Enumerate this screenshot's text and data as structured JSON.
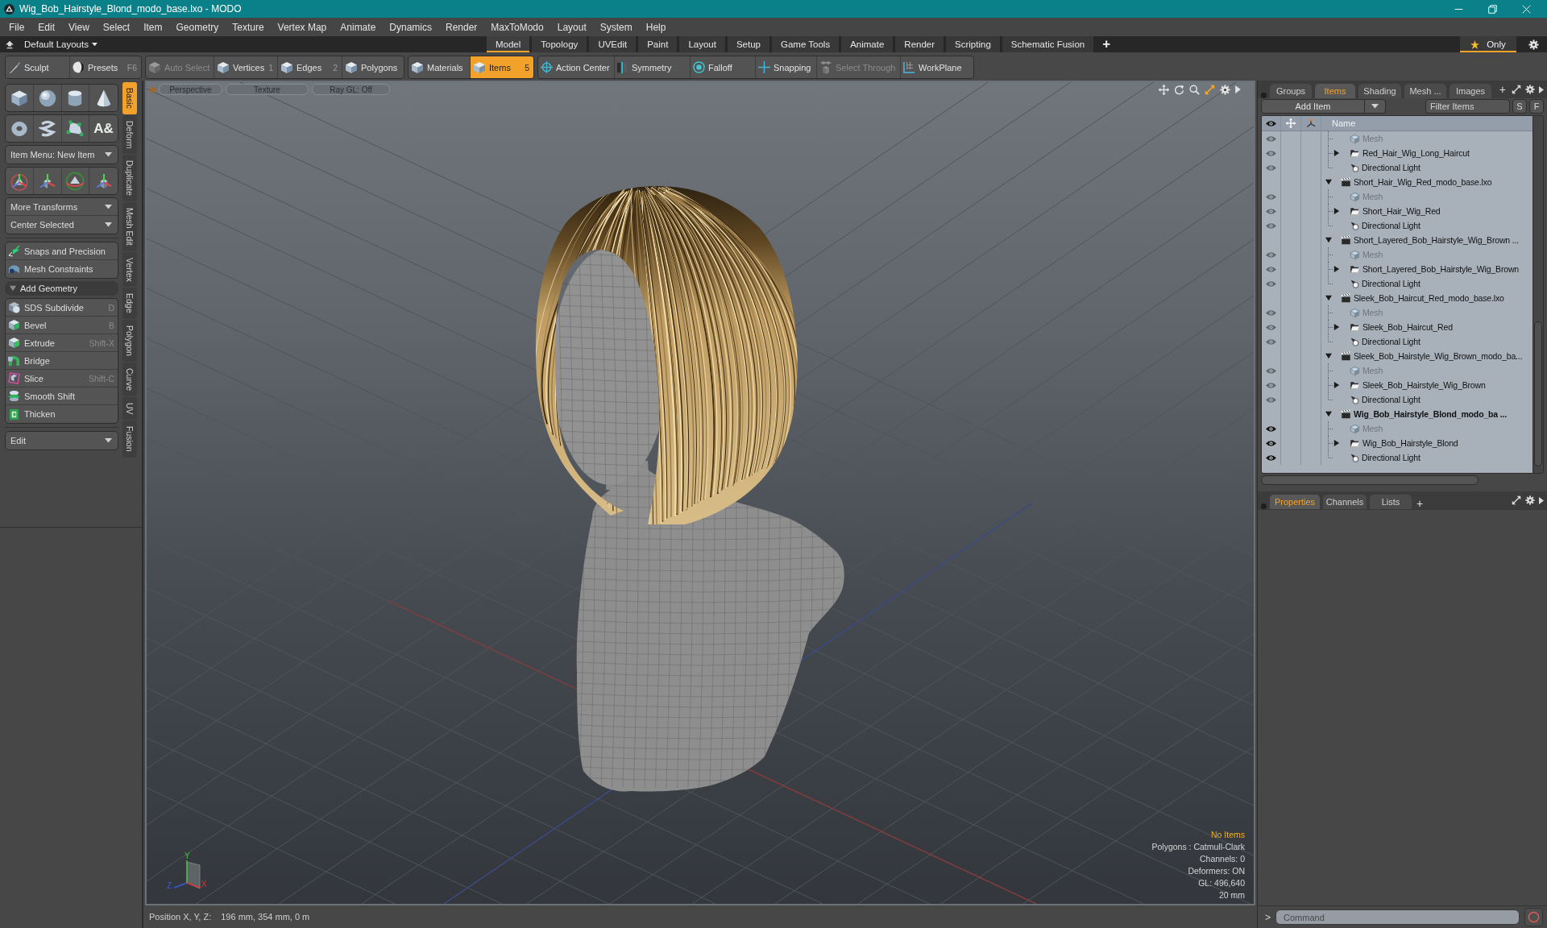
{
  "window": {
    "title": "Wig_Bob_Hairstyle_Blond_modo_base.lxo - MODO"
  },
  "menu": [
    "File",
    "Edit",
    "View",
    "Select",
    "Item",
    "Geometry",
    "Texture",
    "Vertex Map",
    "Animate",
    "Dynamics",
    "Render",
    "MaxToModo",
    "Layout",
    "System",
    "Help"
  ],
  "layout_bar": {
    "preset": "Default Layouts",
    "tabs": [
      {
        "label": "Model",
        "selected": true
      },
      {
        "label": "Topology",
        "selected": false
      },
      {
        "label": "UVEdit",
        "selected": false
      },
      {
        "label": "Paint",
        "selected": false
      },
      {
        "label": "Layout",
        "selected": false
      },
      {
        "label": "Setup",
        "selected": false
      },
      {
        "label": "Game Tools",
        "selected": false
      },
      {
        "label": "Animate",
        "selected": false
      },
      {
        "label": "Render",
        "selected": false
      },
      {
        "label": "Scripting",
        "selected": false
      },
      {
        "label": "Schematic Fusion",
        "selected": false
      }
    ],
    "add_tab": "+",
    "only_filter": {
      "label": "Only",
      "on": true
    }
  },
  "toolbar": {
    "groups": [
      {
        "buttons": [
          {
            "label": "Sculpt",
            "selected": false,
            "disabled": false
          },
          {
            "label": "Presets",
            "shortcut": "F6",
            "selected": false,
            "disabled": false
          }
        ]
      },
      {
        "buttons": [
          {
            "label": "Auto Select",
            "selected": false,
            "disabled": true
          },
          {
            "label": "Vertices",
            "shortcut": "1",
            "selected": false,
            "disabled": false
          },
          {
            "label": "Edges",
            "shortcut": "2",
            "selected": false,
            "disabled": false
          },
          {
            "label": "Polygons",
            "selected": false,
            "disabled": false
          }
        ]
      },
      {
        "buttons": [
          {
            "label": "Materials",
            "selected": false,
            "disabled": false
          },
          {
            "label": "Items",
            "shortcut": "5",
            "selected": true,
            "disabled": false
          }
        ]
      },
      {
        "buttons": [
          {
            "label": "Action Center",
            "selected": false,
            "disabled": false
          },
          {
            "label": "Symmetry",
            "selected": false,
            "disabled": false
          },
          {
            "label": "Falloff",
            "selected": false,
            "disabled": false
          },
          {
            "label": "Snapping",
            "selected": false,
            "disabled": false
          },
          {
            "label": "Select Through",
            "selected": false,
            "disabled": true
          },
          {
            "label": "WorkPlane",
            "selected": false,
            "disabled": false
          }
        ]
      }
    ]
  },
  "tool_palette": {
    "text_tool": "A&",
    "item_menu": "Item Menu: New Item",
    "transform_menus": [
      "More Transforms",
      "Center Selected"
    ],
    "constraints": [
      "Snaps and Precision",
      "Mesh Constraints"
    ],
    "add_geometry": {
      "title": "Add Geometry",
      "expanded": true,
      "tools": [
        {
          "label": "SDS Subdivide",
          "shortcut": "D"
        },
        {
          "label": "Bevel",
          "shortcut": "B"
        },
        {
          "label": "Extrude",
          "shortcut": "Shift-X"
        },
        {
          "label": "Bridge"
        },
        {
          "label": "Slice",
          "shortcut": "Shift-C"
        },
        {
          "label": "Smooth Shift"
        },
        {
          "label": "Thicken"
        }
      ]
    },
    "edit_menu": "Edit"
  },
  "side_tabs": [
    {
      "label": "Basic",
      "selected": true
    },
    {
      "label": "Deform",
      "selected": false
    },
    {
      "label": "Duplicate",
      "selected": false
    },
    {
      "label": "Mesh Edit",
      "selected": false
    },
    {
      "label": "Vertex",
      "selected": false
    },
    {
      "label": "Edge",
      "selected": false
    },
    {
      "label": "Polygon",
      "selected": false
    },
    {
      "label": "Curve",
      "selected": false
    },
    {
      "label": "UV",
      "selected": false
    },
    {
      "label": "Fusion",
      "selected": false
    }
  ],
  "viewport": {
    "view_buttons": [
      "Perspective",
      "Texture",
      "Ray GL: Off"
    ],
    "selection": "No Items",
    "stats": [
      "Polygons : Catmull-Clark",
      "Channels: 0",
      "Deformers: ON",
      "GL: 496,640",
      "20 mm"
    ],
    "axis_labels": [
      "Y",
      "Z",
      "X"
    ]
  },
  "status_bar": {
    "label": "Position X, Y, Z:",
    "value": "196 mm, 354 mm, 0 m"
  },
  "items_panel": {
    "tabs": [
      {
        "label": "Groups",
        "selected": false
      },
      {
        "label": "Items",
        "selected": true
      },
      {
        "label": "Shading",
        "selected": false
      },
      {
        "label": "Mesh ...",
        "selected": false
      },
      {
        "label": "Images",
        "selected": false
      }
    ],
    "add_tab": "+",
    "add_item": "Add Item",
    "filter": {
      "placeholder": "Filter Items"
    },
    "toggles": [
      "S",
      "F"
    ],
    "column": "Name",
    "tree": [
      {
        "children": [
          {
            "label": "Mesh",
            "kind": "mesh",
            "visible": true
          },
          {
            "label": "Red_Hair_Wig_Long_Haircut",
            "kind": "group",
            "expanded": false,
            "visible": true
          },
          {
            "label": "Directional Light",
            "kind": "light",
            "visible": true
          }
        ]
      },
      {
        "label": "Short_Hair_Wig_Red_modo_base.lxo",
        "kind": "scene",
        "expanded": true,
        "current": false,
        "children": [
          {
            "label": "Mesh",
            "kind": "mesh",
            "visible": true
          },
          {
            "label": "Short_Hair_Wig_Red",
            "kind": "group",
            "expanded": false,
            "visible": true
          },
          {
            "label": "Directional Light",
            "kind": "light",
            "visible": true
          }
        ]
      },
      {
        "label": "Short_Layered_Bob_Hairstyle_Wig_Brown ...",
        "kind": "scene",
        "expanded": true,
        "current": false,
        "children": [
          {
            "label": "Mesh",
            "kind": "mesh",
            "visible": true
          },
          {
            "label": "Short_Layered_Bob_Hairstyle_Wig_Brown",
            "kind": "group",
            "expanded": false,
            "visible": true
          },
          {
            "label": "Directional Light",
            "kind": "light",
            "visible": true
          }
        ]
      },
      {
        "label": "Sleek_Bob_Haircut_Red_modo_base.lxo",
        "kind": "scene",
        "expanded": true,
        "current": false,
        "children": [
          {
            "label": "Mesh",
            "kind": "mesh",
            "visible": true
          },
          {
            "label": "Sleek_Bob_Haircut_Red",
            "kind": "group",
            "expanded": false,
            "visible": true
          },
          {
            "label": "Directional Light",
            "kind": "light",
            "visible": true
          }
        ]
      },
      {
        "label": "Sleek_Bob_Hairstyle_Wig_Brown_modo_ba...",
        "kind": "scene",
        "expanded": true,
        "current": false,
        "children": [
          {
            "label": "Mesh",
            "kind": "mesh",
            "visible": true
          },
          {
            "label": "Sleek_Bob_Hairstyle_Wig_Brown",
            "kind": "group",
            "expanded": false,
            "visible": true
          },
          {
            "label": "Directional Light",
            "kind": "light",
            "visible": true
          }
        ]
      },
      {
        "label": "Wig_Bob_Hairstyle_Blond_modo_ba ...",
        "kind": "scene",
        "expanded": true,
        "current": true,
        "children": [
          {
            "label": "Mesh",
            "kind": "mesh",
            "visible": true
          },
          {
            "label": "Wig_Bob_Hairstyle_Blond",
            "kind": "group",
            "expanded": false,
            "visible": true
          },
          {
            "label": "Directional Light",
            "kind": "light",
            "visible": true
          }
        ]
      }
    ]
  },
  "properties_panel": {
    "tabs": [
      {
        "label": "Properties",
        "selected": true
      },
      {
        "label": "Channels",
        "selected": false
      },
      {
        "label": "Lists",
        "selected": false
      }
    ],
    "add_tab": "+"
  },
  "command": {
    "prompt": ">",
    "placeholder": "Command"
  }
}
